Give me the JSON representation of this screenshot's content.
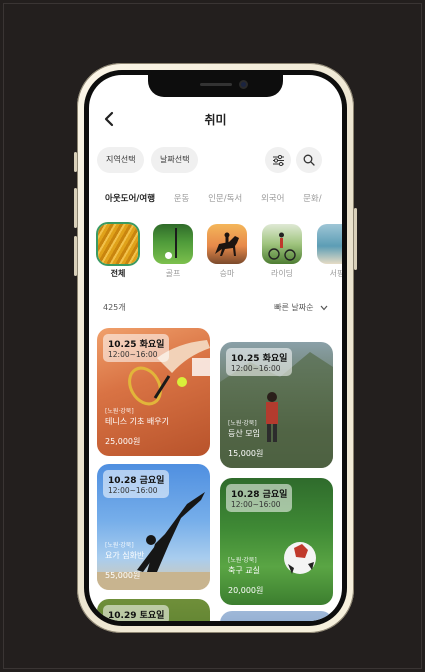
{
  "header": {
    "title": "취미"
  },
  "filters": {
    "region_label": "지역선택",
    "date_label": "날짜선택"
  },
  "icons": {
    "back": "chevron-left-icon",
    "filter": "sliders-icon",
    "search": "search-icon",
    "sort_caret": "chevron-down-icon"
  },
  "tabs": [
    "아웃도어/여행",
    "운동",
    "인문/독서",
    "외국어",
    "문화/"
  ],
  "subcategories": [
    "전체",
    "골프",
    "승마",
    "라이딩",
    "서핑"
  ],
  "list": {
    "count": "425개",
    "sort_label": "빠른 날짜순"
  },
  "cards": [
    {
      "date": "10.25 화요일",
      "time": "12:00~16:00",
      "area": "[노원·강북]",
      "name": "테니스 기초 배우기",
      "price": "25,000원"
    },
    {
      "date": "10.25 화요일",
      "time": "12:00~16:00",
      "area": "[노원·강북]",
      "name": "등산 모임",
      "price": "15,000원"
    },
    {
      "date": "10.28 금요일",
      "time": "12:00~16:00",
      "area": "[노원·강북]",
      "name": "요가 심화반",
      "price": "55,000원"
    },
    {
      "date": "10.28 금요일",
      "time": "12:00~16:00",
      "area": "[노원·강북]",
      "name": "축구 교실",
      "price": "20,000원"
    },
    {
      "date": "10.29 토요일",
      "time": "",
      "area": "",
      "name": "",
      "price": ""
    }
  ],
  "colors": {
    "accent": "#3b9a62",
    "background": "#231f1e",
    "pill": "#f0f0f0"
  }
}
